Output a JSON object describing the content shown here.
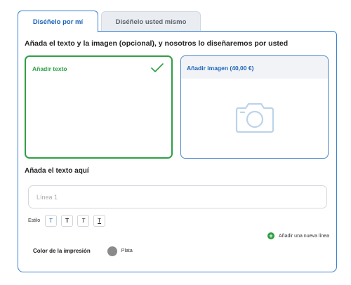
{
  "tabs": [
    {
      "label": "Diséñelo por mí",
      "active": true
    },
    {
      "label": "Diséñelo usted mismo",
      "active": false
    }
  ],
  "panel": {
    "heading": "Añada el texto y la imagen (opcional), y nosotros lo diseñaremos por usted",
    "cards": {
      "text": {
        "title": "Añadir texto",
        "icon": "checkmark-icon",
        "selected": true
      },
      "image": {
        "title": "Añadir imagen (40,00 €)",
        "icon": "camera-icon"
      }
    },
    "text_section": {
      "heading": "Añada el texto aquí",
      "input_placeholder": "Línea 1",
      "input_value": "",
      "style_label": "Estilo",
      "style_buttons": [
        "T",
        "T",
        "T",
        "T"
      ],
      "add_line_label": "Añadir una nueva línea"
    },
    "print_color": {
      "label": "Color de la impresión",
      "value": "Plata",
      "swatch_color": "#8a8a8a"
    }
  },
  "colors": {
    "accent_blue": "#1c62b9",
    "selected_green": "#2e9f43"
  }
}
